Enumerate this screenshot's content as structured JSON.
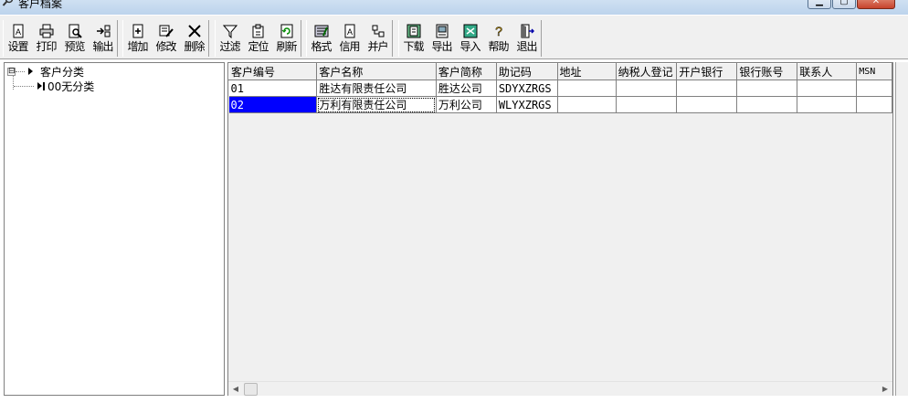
{
  "window": {
    "title": "客户档案",
    "minimize_glyph": "▁",
    "maximize_glyph": "▢",
    "close_glyph": "✕"
  },
  "toolbar": {
    "groups": [
      [
        {
          "label": "设置",
          "icon": "settings-icon"
        },
        {
          "label": "打印",
          "icon": "print-icon"
        },
        {
          "label": "预览",
          "icon": "preview-icon"
        },
        {
          "label": "输出",
          "icon": "export-icon"
        }
      ],
      [
        {
          "label": "增加",
          "icon": "add-icon"
        },
        {
          "label": "修改",
          "icon": "edit-icon"
        },
        {
          "label": "删除",
          "icon": "delete-icon"
        }
      ],
      [
        {
          "label": "过滤",
          "icon": "filter-icon"
        },
        {
          "label": "定位",
          "icon": "locate-icon"
        },
        {
          "label": "刷新",
          "icon": "refresh-icon"
        }
      ],
      [
        {
          "label": "格式",
          "icon": "format-icon"
        },
        {
          "label": "信用",
          "icon": "credit-icon"
        },
        {
          "label": "并户",
          "icon": "merge-icon"
        }
      ],
      [
        {
          "label": "下载",
          "icon": "download-icon"
        },
        {
          "label": "导出",
          "icon": "export-data-icon"
        },
        {
          "label": "导入",
          "icon": "import-icon"
        },
        {
          "label": "帮助",
          "icon": "help-icon"
        },
        {
          "label": "退出",
          "icon": "exit-icon"
        }
      ]
    ]
  },
  "tree": {
    "root": {
      "expander": "⊟",
      "label": "客户分类"
    },
    "child": {
      "label": "00无分类"
    }
  },
  "grid": {
    "columns": [
      "客户编号",
      "客户名称",
      "客户简称",
      "助记码",
      "地址",
      "纳税人登记",
      "开户银行",
      "银行账号",
      "联系人",
      "MSN"
    ],
    "rows": [
      [
        "01",
        "胜达有限责任公司",
        "胜达公司",
        "SDYXZRGS",
        "",
        "",
        "",
        "",
        "",
        ""
      ],
      [
        "02",
        "万利有限责任公司",
        "万利公司",
        "WLYXZRGS",
        "",
        "",
        "",
        "",
        "",
        ""
      ]
    ],
    "selected_row": 1
  },
  "scrollbar": {
    "left_arrow": "◀",
    "right_arrow": "▶"
  }
}
